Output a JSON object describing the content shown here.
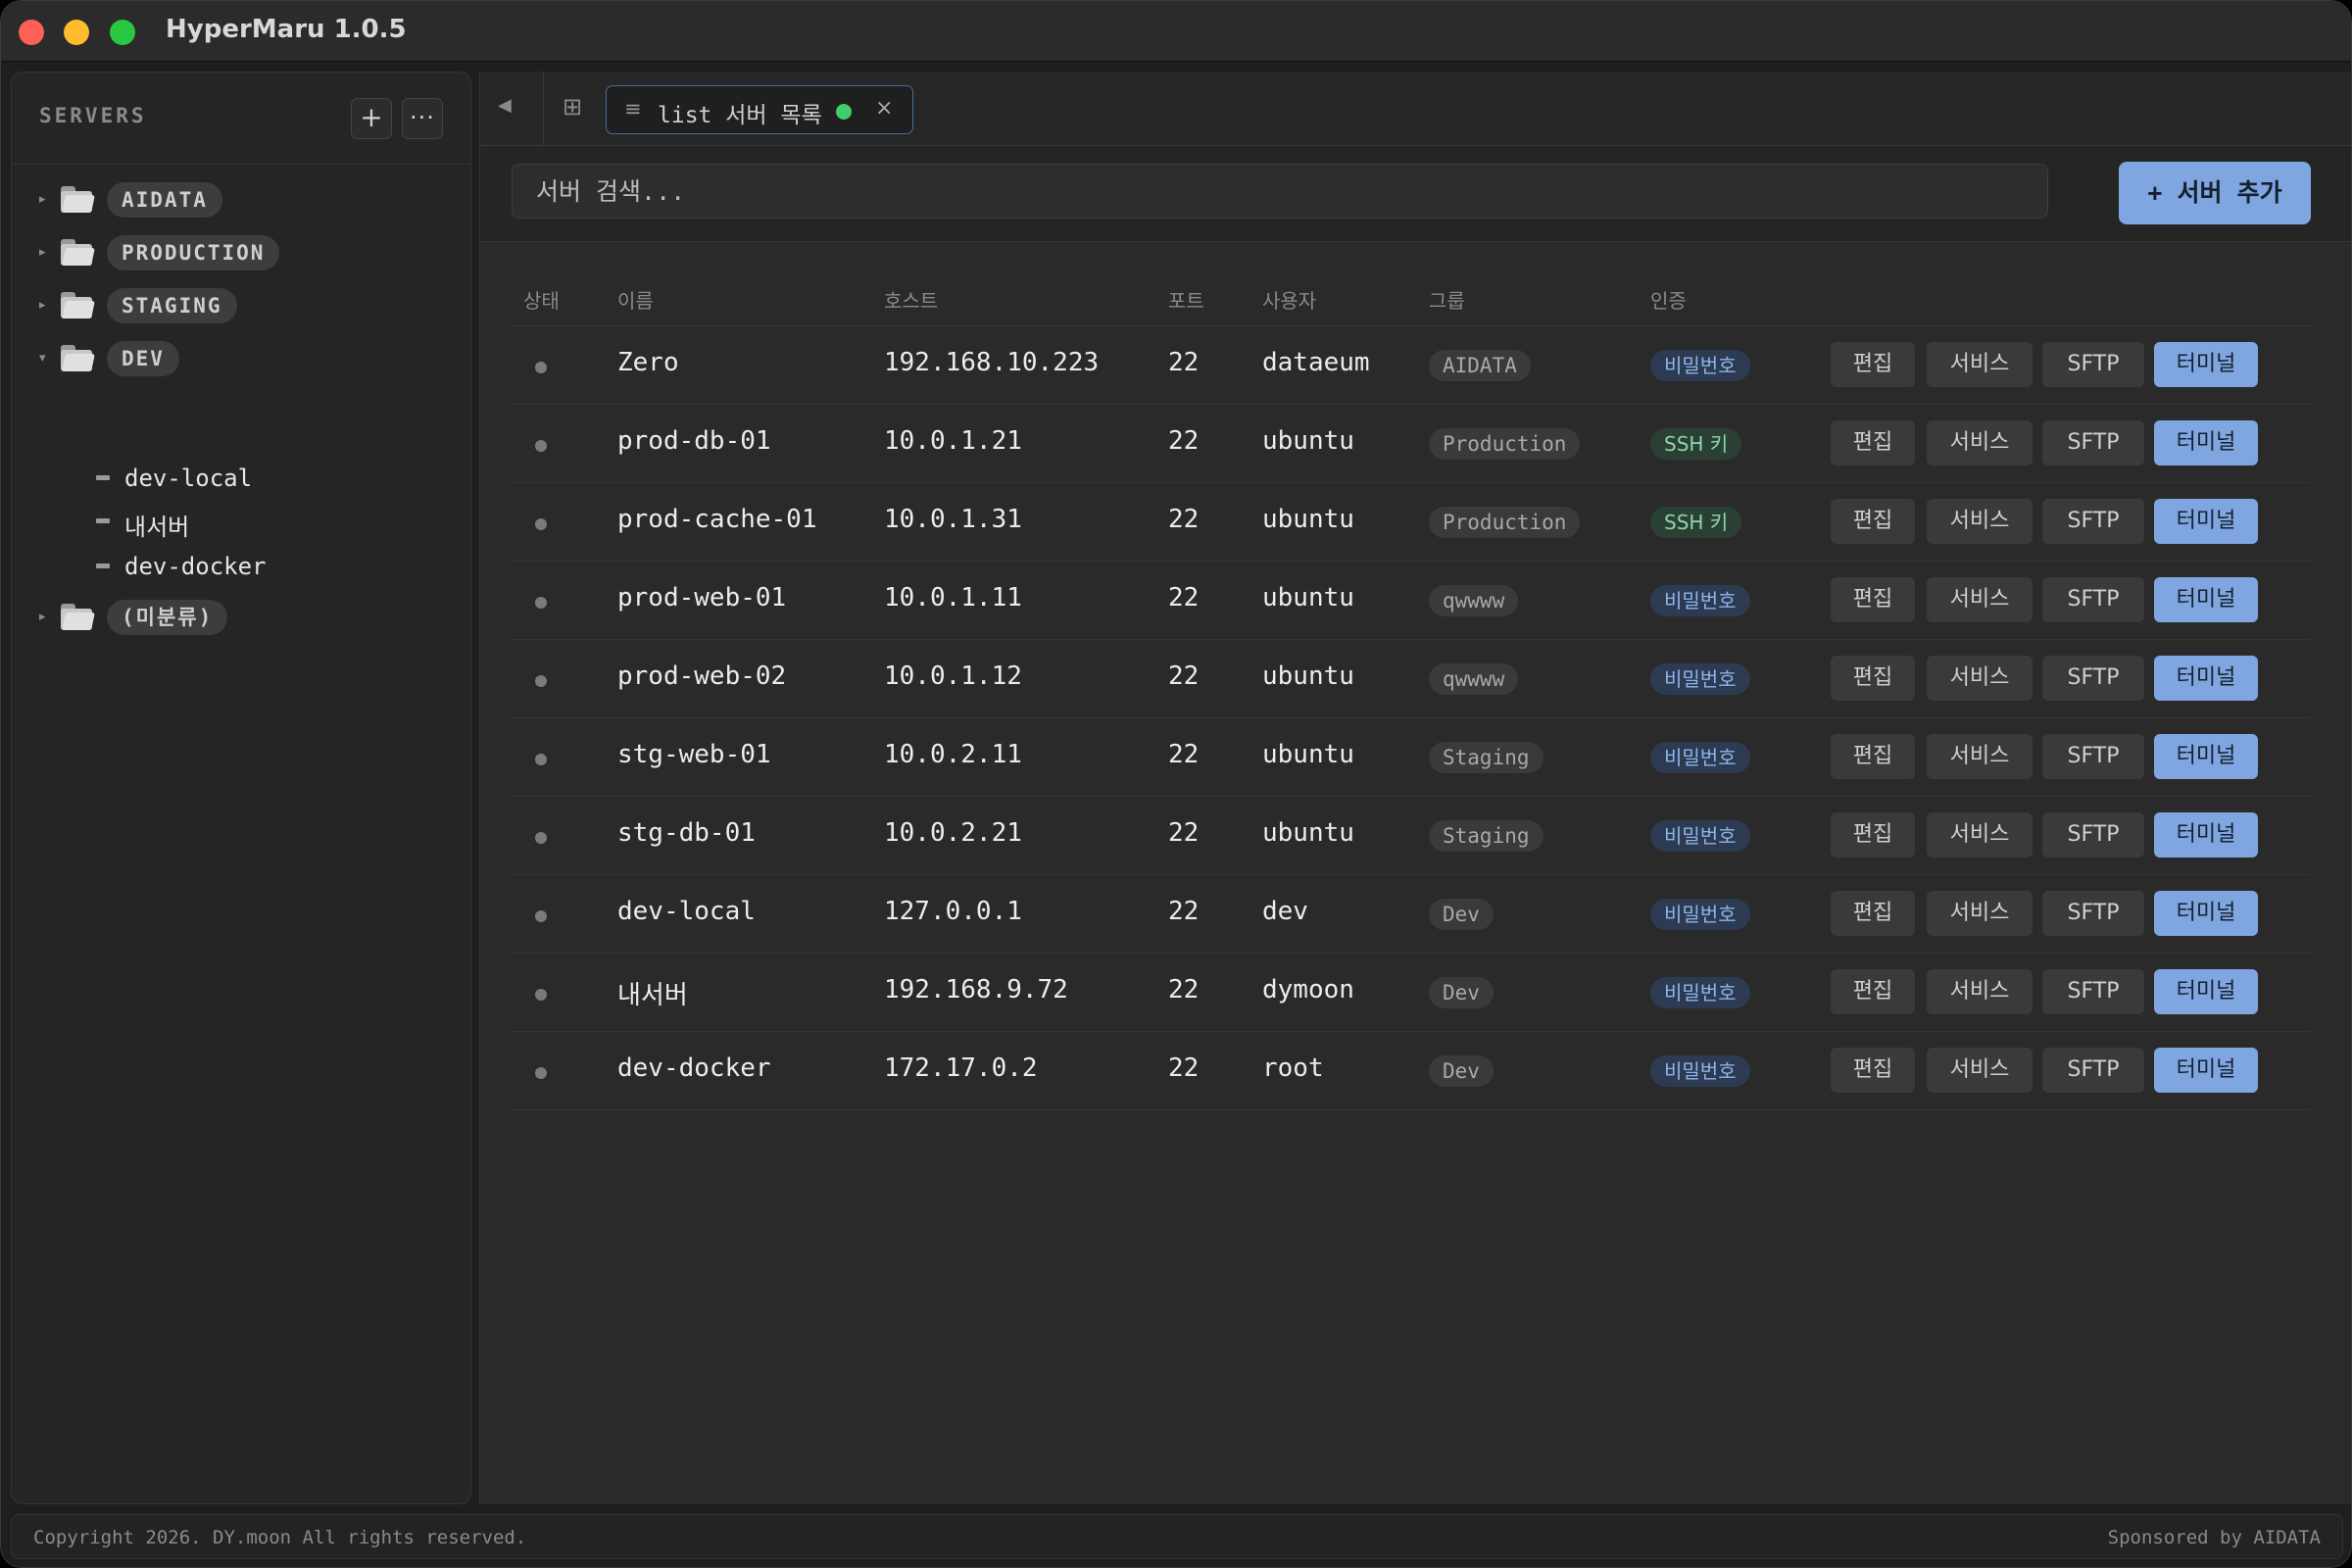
{
  "window": {
    "title": "HyperMaru 1.0.5"
  },
  "sidebar": {
    "title": "SERVERS",
    "add_label": "+",
    "more_label": "···",
    "folders": [
      {
        "label": "AIDATA",
        "expanded": false
      },
      {
        "label": "PRODUCTION",
        "expanded": false
      },
      {
        "label": "STAGING",
        "expanded": false
      },
      {
        "label": "DEV",
        "expanded": true
      },
      {
        "label": "(미분류)",
        "expanded": false
      }
    ],
    "dev_children": [
      "dev-local",
      "내서버",
      "dev-docker"
    ]
  },
  "tabbar": {
    "back_icon": "◀",
    "grid_icon": "⊞",
    "tab": {
      "icon": "≡",
      "label": "list 서버 목록",
      "status_color": "#3ecf6a",
      "close": "×"
    }
  },
  "toolbar": {
    "search_placeholder": "서버 검색...",
    "add_server_label": "+ 서버 추가"
  },
  "table": {
    "headers": {
      "status": "상태",
      "name": "이름",
      "host": "호스트",
      "port": "포트",
      "user": "사용자",
      "group": "그룹",
      "auth": "인증"
    },
    "actions": {
      "edit": "편집",
      "services": "서비스",
      "sftp": "SFTP",
      "terminal": "터미널"
    },
    "rows": [
      {
        "name": "Zero",
        "host": "192.168.10.223",
        "port": "22",
        "user": "dataeum",
        "group": "AIDATA",
        "auth": "비밀번호",
        "auth_type": "pw"
      },
      {
        "name": "prod-db-01",
        "host": "10.0.1.21",
        "port": "22",
        "user": "ubuntu",
        "group": "Production",
        "auth": "SSH 키",
        "auth_type": "ssh"
      },
      {
        "name": "prod-cache-01",
        "host": "10.0.1.31",
        "port": "22",
        "user": "ubuntu",
        "group": "Production",
        "auth": "SSH 키",
        "auth_type": "ssh"
      },
      {
        "name": "prod-web-01",
        "host": "10.0.1.11",
        "port": "22",
        "user": "ubuntu",
        "group": "qwwww",
        "auth": "비밀번호",
        "auth_type": "pw"
      },
      {
        "name": "prod-web-02",
        "host": "10.0.1.12",
        "port": "22",
        "user": "ubuntu",
        "group": "qwwww",
        "auth": "비밀번호",
        "auth_type": "pw"
      },
      {
        "name": "stg-web-01",
        "host": "10.0.2.11",
        "port": "22",
        "user": "ubuntu",
        "group": "Staging",
        "auth": "비밀번호",
        "auth_type": "pw"
      },
      {
        "name": "stg-db-01",
        "host": "10.0.2.21",
        "port": "22",
        "user": "ubuntu",
        "group": "Staging",
        "auth": "비밀번호",
        "auth_type": "pw"
      },
      {
        "name": "dev-local",
        "host": "127.0.0.1",
        "port": "22",
        "user": "dev",
        "group": "Dev",
        "auth": "비밀번호",
        "auth_type": "pw"
      },
      {
        "name": "내서버",
        "host": "192.168.9.72",
        "port": "22",
        "user": "dymoon",
        "group": "Dev",
        "auth": "비밀번호",
        "auth_type": "pw"
      },
      {
        "name": "dev-docker",
        "host": "172.17.0.2",
        "port": "22",
        "user": "root",
        "group": "Dev",
        "auth": "비밀번호",
        "auth_type": "pw"
      }
    ]
  },
  "footer": {
    "left": "Copyright 2026. DY.moon All rights reserved.",
    "right": "Sponsored by AIDATA"
  },
  "colors": {
    "accent": "#7fa6e0",
    "online": "#3ecf6a",
    "ssh_badge": "#8fd6a6",
    "pw_badge": "#8eb4ea"
  }
}
